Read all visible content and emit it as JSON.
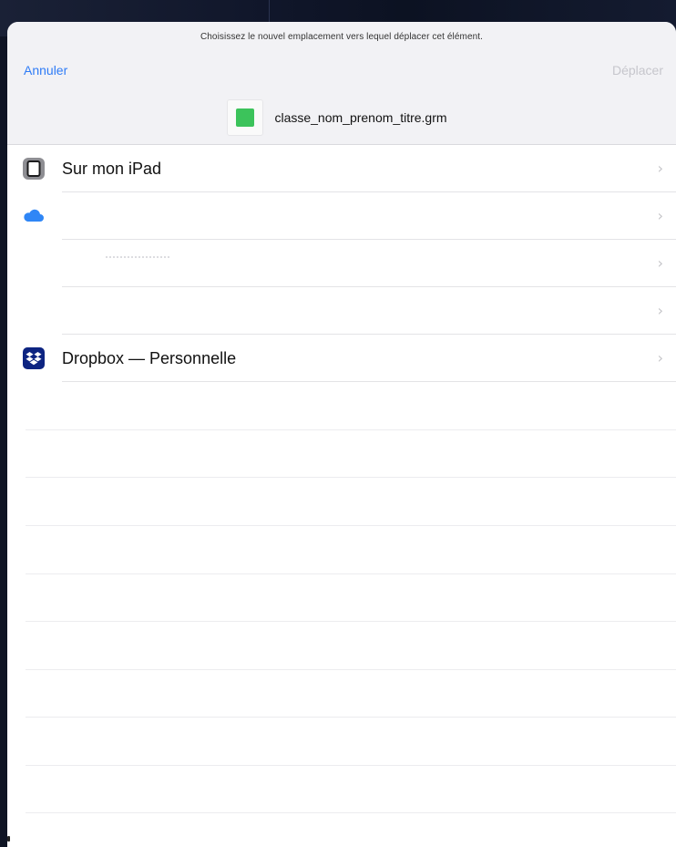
{
  "header": {
    "prompt": "Choisissez le nouvel emplacement vers lequel déplacer cet élément.",
    "cancel_label": "Annuler",
    "move_label": "Déplacer",
    "file_name": "classe_nom_prenom_titre.grm",
    "file_icon": "green-document-icon"
  },
  "locations": [
    {
      "label": "Sur mon iPad",
      "icon": "ipad-icon"
    },
    {
      "label": "",
      "icon": "icloud-icon"
    },
    {
      "label": "",
      "icon": ""
    },
    {
      "label": "",
      "icon": ""
    },
    {
      "label": "Dropbox — Personnelle",
      "icon": "dropbox-icon"
    }
  ],
  "chevron": "›",
  "colors": {
    "accent": "#2f7cf6",
    "disabled": "#c6c6cc",
    "header_bg": "#f2f2f5",
    "dropbox": "#0d2481",
    "file_green": "#3cc35b"
  }
}
